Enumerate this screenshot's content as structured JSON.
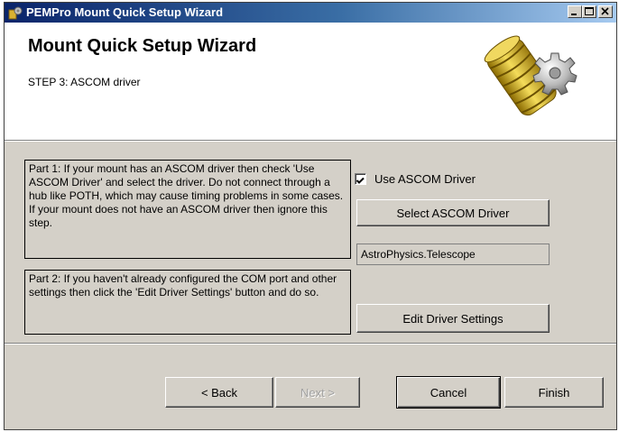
{
  "window": {
    "title": "PEMPro Mount Quick Setup Wizard",
    "controls": [
      "minimize",
      "maximize",
      "close"
    ]
  },
  "header": {
    "title": "Mount Quick Setup Wizard",
    "subtitle": "STEP 3: ASCOM driver",
    "logo_icon": "gears-icon"
  },
  "part1": {
    "text": "Part 1:  If your mount has an ASCOM driver then check 'Use ASCOM Driver' and select the driver. Do not connect through a hub like POTH, which may cause timing problems in some cases.  If your mount does not have an ASCOM driver then ignore this step."
  },
  "part2": {
    "text": "Part 2:  If you haven't already configured the COM port and other settings then click the 'Edit Driver Settings' button and do so."
  },
  "ascom": {
    "use_checkbox_label": "Use ASCOM Driver",
    "use_checked": true,
    "select_button": "Select ASCOM Driver",
    "driver_value": "AstroPhysics.Telescope",
    "edit_button": "Edit Driver Settings"
  },
  "nav": {
    "back": "< Back",
    "next": "Next >",
    "cancel": "Cancel",
    "finish": "Finish"
  },
  "colors": {
    "titlebar_start": "#0a246a",
    "titlebar_end": "#a6caf0",
    "face": "#d4d0c8"
  }
}
